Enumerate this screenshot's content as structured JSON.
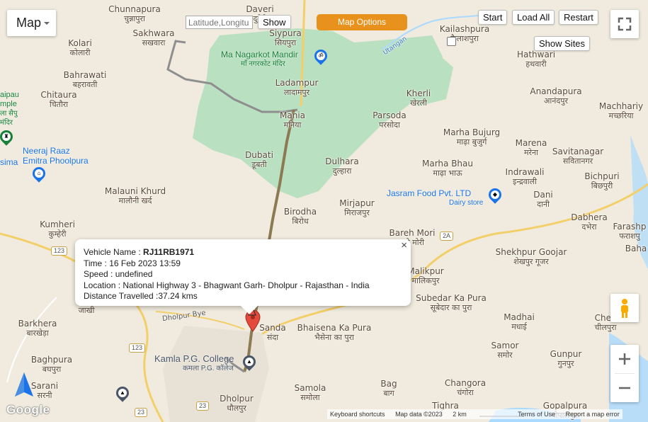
{
  "map_type": {
    "label": "Map"
  },
  "search": {
    "placeholder": "Latitude,Longitu",
    "show_label": "Show"
  },
  "map_options_label": "Map Options",
  "playback": {
    "start": "Start",
    "load_all": "Load All",
    "restart": "Restart",
    "show_sites": "Show Sites"
  },
  "popup": {
    "vehicle_label": "Vehicle Name : ",
    "vehicle_name": "RJ11RB1971",
    "time": "Time : 16 Feb 2023 13:59",
    "speed": "Speed : undefined",
    "location": "Location : National Highway 3 - Bhagwant Garh- Dholpur - Rajasthan - India",
    "distance": "Distance Travelled :37.24 kms",
    "close": "×"
  },
  "places": [
    {
      "en": "Chunnapura",
      "hi": "चुन्नापुरा"
    },
    {
      "en": "Daveri",
      "hi": "दुवेरी"
    },
    {
      "en": "Sakhwara",
      "hi": "सखवारा"
    },
    {
      "en": "Kolari",
      "hi": "कोलारी"
    },
    {
      "en": "Siypura",
      "hi": "सियपुरा"
    },
    {
      "en": "Kailashpura",
      "hi": "कैलाशपुरा"
    },
    {
      "en": "Hathwari",
      "hi": "हथवारी"
    },
    {
      "en": "Bahrawati",
      "hi": "बहरावती"
    },
    {
      "en": "Ladampur",
      "hi": "लादामपुर"
    },
    {
      "en": "Anandapura",
      "hi": "आनंदपुर"
    },
    {
      "en": "Chitaura",
      "hi": "चितौरा"
    },
    {
      "en": "Kherli",
      "hi": "खेरली"
    },
    {
      "en": "Machhariy",
      "hi": "मच्छरिया"
    },
    {
      "en": "Mania",
      "hi": "मनिया"
    },
    {
      "en": "Parsoda",
      "hi": "परसोदा"
    },
    {
      "en": "Marha Bujurg",
      "hi": "माढ़ा बुजुर्ग"
    },
    {
      "en": "Marena",
      "hi": "मरेना"
    },
    {
      "en": "Savitanagar",
      "hi": "सवितानगर"
    },
    {
      "en": "Dubati",
      "hi": "डूबती"
    },
    {
      "en": "Dulhara",
      "hi": "दुल्हारा"
    },
    {
      "en": "Marha Bhau",
      "hi": "माढ़ा भाऊ"
    },
    {
      "en": "Indrawali",
      "hi": "इन्द्रवाली"
    },
    {
      "en": "Bichpuri",
      "hi": "बिछपुरी"
    },
    {
      "en": "Malauni Khurd",
      "hi": "मालौनी खर्द"
    },
    {
      "en": "Dani",
      "hi": "दानी"
    },
    {
      "en": "Mirjapur",
      "hi": "मिराजपुर"
    },
    {
      "en": "Birodha",
      "hi": "बिरोध"
    },
    {
      "en": "Dabhera",
      "hi": "दभेरा"
    },
    {
      "en": "Kumheri",
      "hi": "कुम्हेरी"
    },
    {
      "en": "Farashp",
      "hi": "फराशपु"
    },
    {
      "en": "Bareh Mori",
      "hi": "बारे मोरी"
    },
    {
      "en": "Baha",
      "hi": ""
    },
    {
      "en": "Shekhpur Goojar",
      "hi": "शेखपुर गूजर"
    },
    {
      "en": "Malikpur",
      "hi": "मालिकपुर"
    },
    {
      "en": "Subedar Ka Pura",
      "hi": "सूबेदार का पुरा"
    },
    {
      "en": "Madhai",
      "hi": "मधाई"
    },
    {
      "en": "Chee",
      "hi": "चीलपुरा"
    },
    {
      "en": "Barkhera",
      "hi": "बारखेड़ा"
    },
    {
      "en": "",
      "hi": "जाखी"
    },
    {
      "en": "Sanda",
      "hi": "संदा"
    },
    {
      "en": "Bhaisena Ka Pura",
      "hi": "भैसेना का पुरा"
    },
    {
      "en": "Samor",
      "hi": "समोर"
    },
    {
      "en": "Gunpur",
      "hi": "गुनपुर"
    },
    {
      "en": "Baghpura",
      "hi": "बघपुरा"
    },
    {
      "en": "Sarani",
      "hi": "सरनी"
    },
    {
      "en": "Bag",
      "hi": "बाग"
    },
    {
      "en": "Changora",
      "hi": "चंगोरा"
    },
    {
      "en": "Samola",
      "hi": "समोला"
    },
    {
      "en": "Dholpur",
      "hi": "धौलपुर"
    },
    {
      "en": "Tighra",
      "hi": ""
    },
    {
      "en": "Gopalpura",
      "hi": "गोपालपुरा"
    }
  ],
  "pois": {
    "mandir": {
      "en": "Ma Nagarkot Mandir",
      "hi": "माँ नगरकोट मंदिर"
    },
    "emitra": {
      "en": "Neeraj Raaz Emitra Phoolpura",
      "line1": "Neeraj Raaz",
      "line2": "Emitra Phoolpura"
    },
    "jasram": {
      "en": "Jasram Food Pvt. LTD",
      "sub": "Dairy store"
    },
    "kamla": {
      "en": "Kamla P.G. College",
      "hi": "कमला P.G. कॉलेज"
    },
    "temple_left": {
      "line1": "aipau",
      "line2": "mple",
      "line3": "ला सैपु",
      "line4": "मंदिर"
    },
    "simo": "sima",
    "dholpur_bye": "Dholpur Bye",
    "river": "Utangan"
  },
  "road_shields": [
    "123",
    "123",
    "123",
    "23",
    "23",
    "2A"
  ],
  "footer": {
    "shortcuts": "Keyboard shortcuts",
    "mapdata": "Map data ©2023",
    "scale": "2 km",
    "terms": "Terms of Use",
    "report": "Report a map error"
  },
  "google_logo": "Google",
  "colors": {
    "accent": "#e8911d",
    "park": "#a8dab5",
    "land": "#f1ece0",
    "water": "#aadaff",
    "route": "#8a7a5a"
  }
}
